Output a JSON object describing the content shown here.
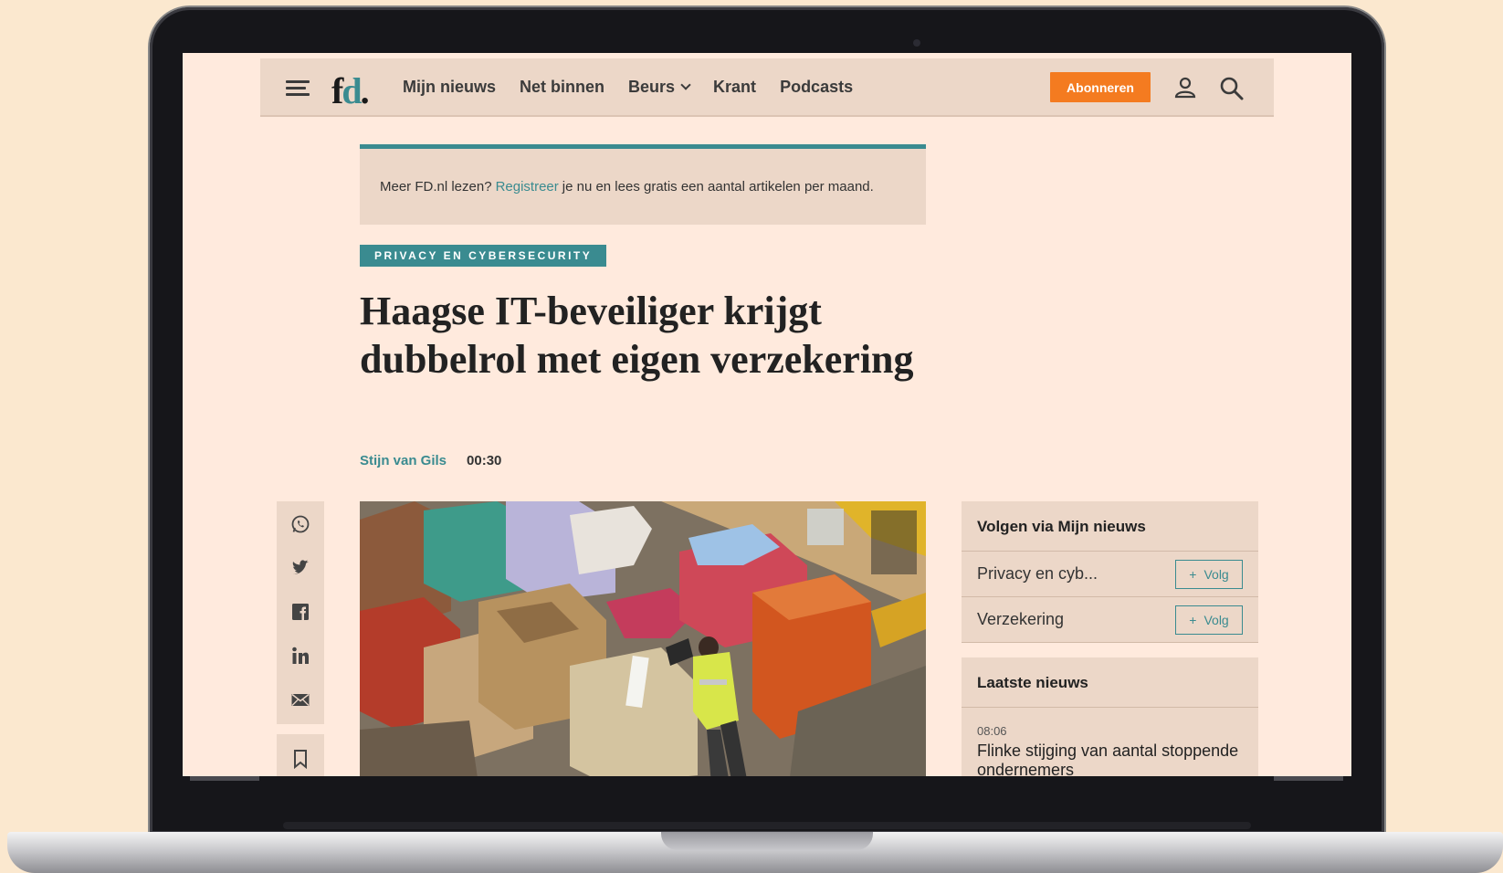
{
  "nav": {
    "logo_main": "f",
    "logo_accent": "d",
    "logo_dot": ".",
    "links": [
      "Mijn nieuws",
      "Net binnen",
      "Beurs",
      "Krant",
      "Podcasts"
    ],
    "subscribe_label": "Abonneren"
  },
  "register": {
    "before": "Meer FD.nl lezen?",
    "link": "Registreer",
    "after": "je nu en lees gratis een aantal artikelen per maand."
  },
  "article": {
    "tag": "PRIVACY EN CYBERSECURITY",
    "headline": "Haagse IT-beveiliger krijgt dubbelrol met eigen verzekering",
    "author": "Stijn van Gils",
    "time": "00:30"
  },
  "share": {
    "icons": [
      "whatsapp-icon",
      "twitter-icon",
      "facebook-icon",
      "linkedin-icon",
      "mail-icon",
      "bookmark-icon"
    ]
  },
  "follow": {
    "title": "Volgen via Mijn nieuws",
    "items": [
      {
        "label": "Privacy en cyb...",
        "button": "Volg"
      },
      {
        "label": "Verzekering",
        "button": "Volg"
      }
    ]
  },
  "latest": {
    "title": "Laatste nieuws",
    "items": [
      {
        "time": "08:06",
        "title": "Flinke stijging van aantal stoppende ondernemers"
      }
    ]
  },
  "colors": {
    "accent": "#3a8b90",
    "subscribe": "#f47b20",
    "page_bg": "#ffeadd",
    "panel_bg": "#ecd7c8",
    "outer_bg": "#fbe8cf"
  }
}
